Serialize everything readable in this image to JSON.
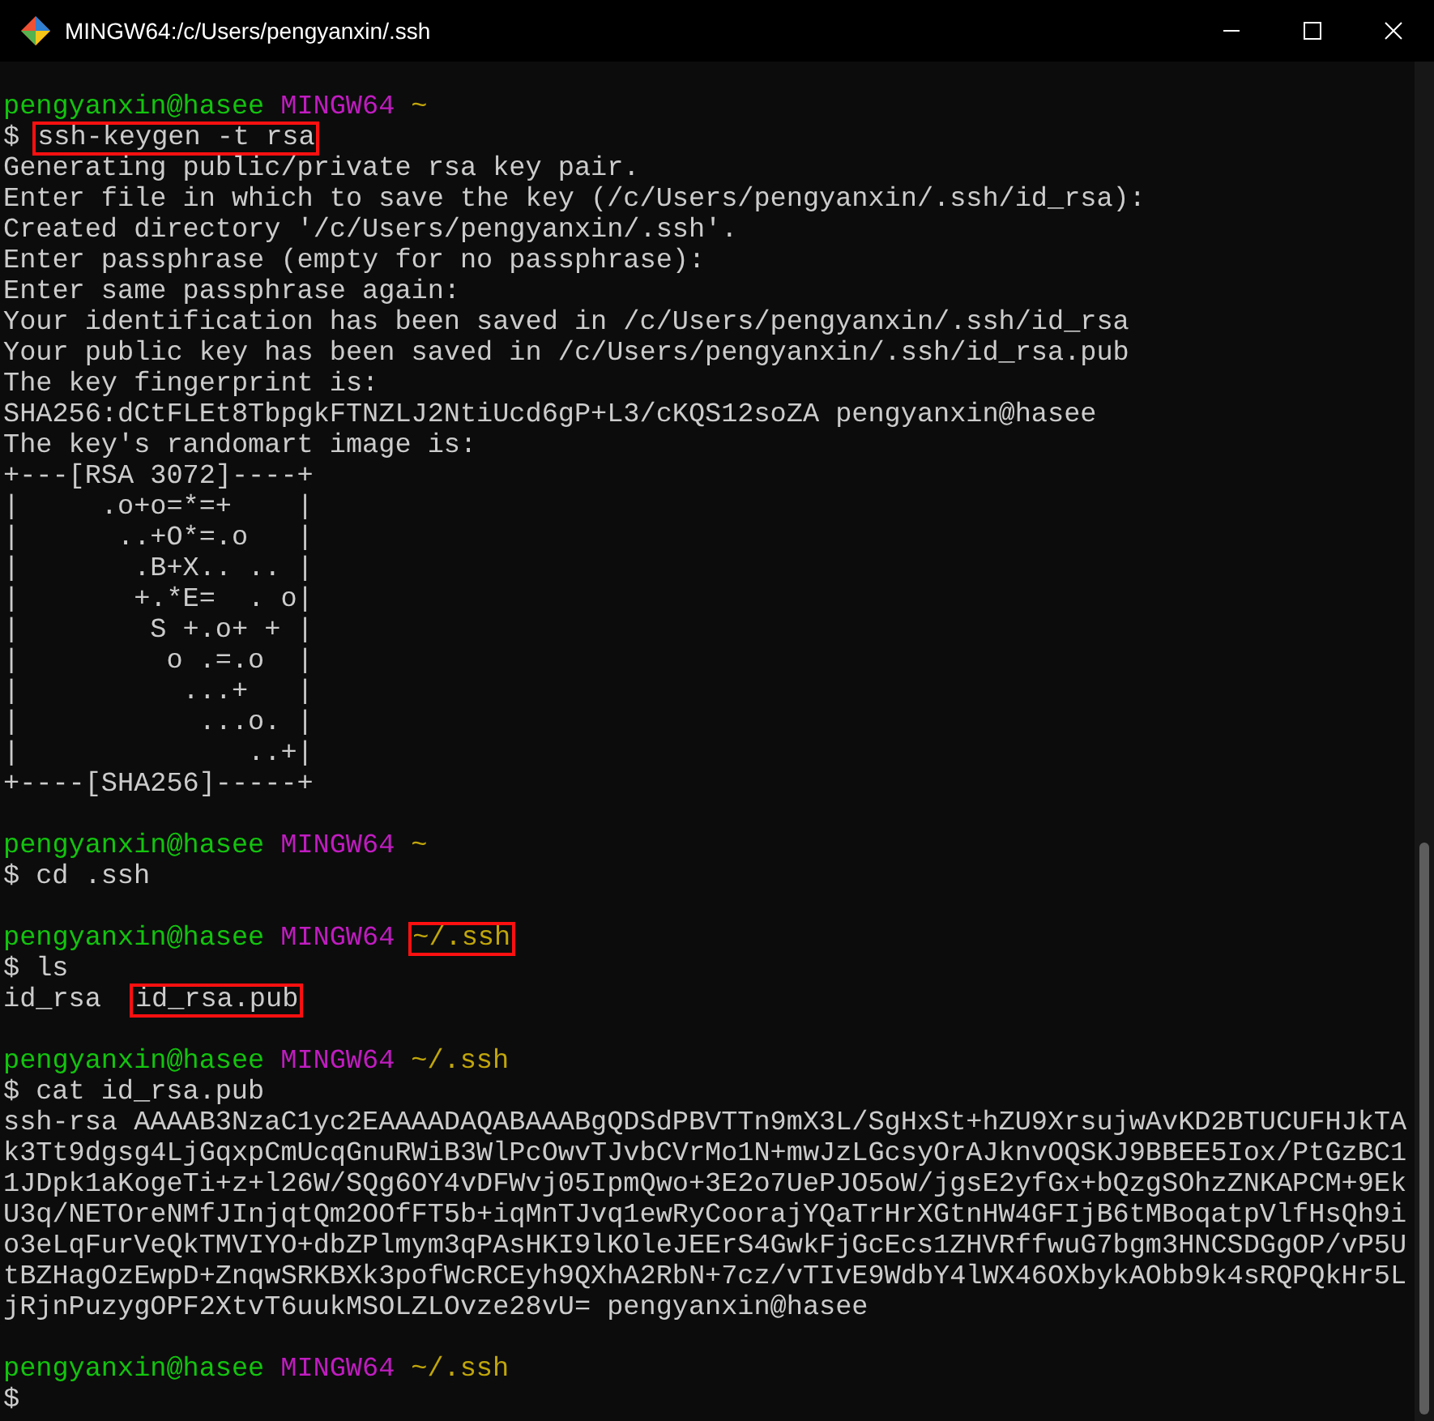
{
  "window": {
    "title": "MINGW64:/c/Users/pengyanxin/.ssh"
  },
  "sessions": [
    {
      "prompt": {
        "user": "pengyanxin@hasee",
        "shell": "MINGW64",
        "path": "~",
        "path_highlighted": false
      },
      "sign": "$",
      "command": "ssh-keygen -t rsa",
      "command_highlighted": true,
      "output": [
        "Generating public/private rsa key pair.",
        "Enter file in which to save the key (/c/Users/pengyanxin/.ssh/id_rsa):",
        "Created directory '/c/Users/pengyanxin/.ssh'.",
        "Enter passphrase (empty for no passphrase):",
        "Enter same passphrase again:",
        "Your identification has been saved in /c/Users/pengyanxin/.ssh/id_rsa",
        "Your public key has been saved in /c/Users/pengyanxin/.ssh/id_rsa.pub",
        "The key fingerprint is:",
        "SHA256:dCtFLEt8TbpgkFTNZLJ2NtiUcd6gP+L3/cKQS12soZA pengyanxin@hasee",
        "The key's randomart image is:",
        "+---[RSA 3072]----+",
        "|     .o+o=*=+    |",
        "|      ..+O*=.o   |",
        "|       .B+X.. .. |",
        "|       +.*E=  . o|",
        "|        S +.o+ + |",
        "|         o .=.o  |",
        "|          ...+   |",
        "|           ...o. |",
        "|              ..+|",
        "+----[SHA256]-----+"
      ]
    },
    {
      "prompt": {
        "user": "pengyanxin@hasee",
        "shell": "MINGW64",
        "path": "~",
        "path_highlighted": false
      },
      "sign": "$",
      "command": "cd .ssh",
      "command_highlighted": false
    },
    {
      "prompt": {
        "user": "pengyanxin@hasee",
        "shell": "MINGW64",
        "path": "~/.ssh",
        "path_highlighted": true
      },
      "sign": "$",
      "command": "ls",
      "command_highlighted": false,
      "files": [
        {
          "name": "id_rsa",
          "highlighted": false
        },
        {
          "name": "id_rsa.pub",
          "highlighted": true
        }
      ]
    },
    {
      "prompt": {
        "user": "pengyanxin@hasee",
        "shell": "MINGW64",
        "path": "~/.ssh",
        "path_highlighted": false
      },
      "sign": "$",
      "command": "cat id_rsa.pub",
      "command_highlighted": false,
      "output": [
        "ssh-rsa AAAAB3NzaC1yc2EAAAADAQABAAABgQDSdPBVTTn9mX3L/SgHxSt+hZU9XrsujwAvKD2BTUCUFHJkTA",
        "k3Tt9dgsg4LjGqxpCmUcqGnuRWiB3WlPcOwvTJvbCVrMo1N+mwJzLGcsyOrAJknvOQSKJ9BBEE5Iox/PtGzBC1",
        "1JDpk1aKogeTi+z+l26W/SQg6OY4vDFWvj05IpmQwo+3E2o7UePJO5oW/jgsE2yfGx+bQzgSOhzZNKAPCM+9Ek",
        "U3q/NETOreNMfJInjqtQm2OOfFT5b+iqMnTJvq1ewRyCoorajYQaTrHrXGtnHW4GFIjB6tMBoqatpVlfHsQh9i",
        "o3eLqFurVeQkTMVIYO+dbZPlmym3qPAsHKI9lKOleJEErS4GwkFjGcEcs1ZHVRffwuG7bgm3HNCSDGgOP/vP5U",
        "tBZHagOzEwpD+ZnqwSRKBXk3pofWcRCEyh9QXhA2RbN+7cz/vTIvE9WdbY4lWX46OXbykAObb9k4sRQPQkHr5L",
        "jRjnPuzygOPF2XtvT6uukMSOLZLOvze28vU= pengyanxin@hasee"
      ]
    },
    {
      "prompt": {
        "user": "pengyanxin@hasee",
        "shell": "MINGW64",
        "path": "~/.ssh",
        "path_highlighted": false
      },
      "sign": "$"
    }
  ]
}
